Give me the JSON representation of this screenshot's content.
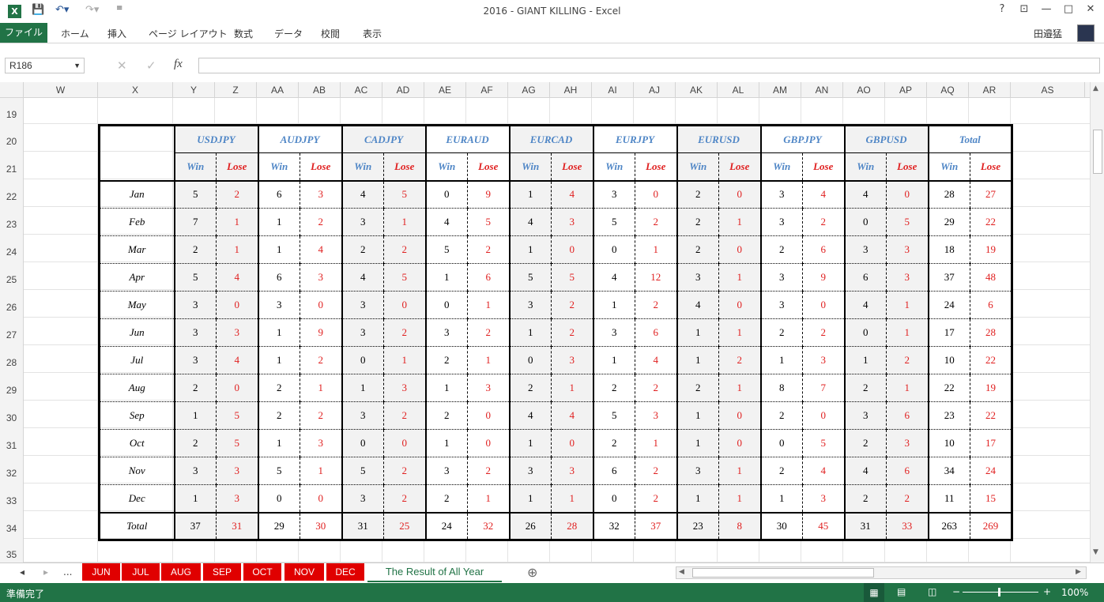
{
  "window": {
    "title": "2016 - GIANT KILLING - Excel",
    "user": "田邉猛",
    "help": "?",
    "minimize": "—",
    "restore": "□",
    "close": "✕",
    "ribbon_opts": "⊡"
  },
  "ribbon": {
    "tabs": [
      "ファイル",
      "ホーム",
      "挿入",
      "ページ レイアウト",
      "数式",
      "データ",
      "校閲",
      "表示"
    ]
  },
  "formula_bar": {
    "name_box": "R186",
    "fx": "fx",
    "cancel": "✕",
    "enter": "✓",
    "value": ""
  },
  "columns": [
    "W",
    "X",
    "Y",
    "Z",
    "AA",
    "AB",
    "AC",
    "AD",
    "AE",
    "AF",
    "AG",
    "AH",
    "AI",
    "AJ",
    "AK",
    "AL",
    "AM",
    "AN",
    "AO",
    "AP",
    "AQ",
    "AR",
    "AS"
  ],
  "rows": [
    "19",
    "20",
    "21",
    "22",
    "23",
    "24",
    "25",
    "26",
    "27",
    "28",
    "29",
    "30",
    "31",
    "32",
    "33",
    "34",
    "35"
  ],
  "table": {
    "pairs": [
      "USDJPY",
      "AUDJPY",
      "CADJPY",
      "EURAUD",
      "EURCAD",
      "EURJPY",
      "EURUSD",
      "GBPJPY",
      "GBPUSD",
      "Total"
    ],
    "win_label": "Win",
    "lose_label": "Lose",
    "months": [
      "Jan",
      "Feb",
      "Mar",
      "Apr",
      "May",
      "Jun",
      "Jul",
      "Aug",
      "Sep",
      "Oct",
      "Nov",
      "Dec"
    ],
    "data": [
      [
        5,
        2,
        6,
        3,
        4,
        5,
        0,
        9,
        1,
        4,
        3,
        0,
        2,
        0,
        3,
        4,
        4,
        0,
        28,
        27
      ],
      [
        7,
        1,
        1,
        2,
        3,
        1,
        4,
        5,
        4,
        3,
        5,
        2,
        2,
        1,
        3,
        2,
        0,
        5,
        29,
        22
      ],
      [
        2,
        1,
        1,
        4,
        2,
        2,
        5,
        2,
        1,
        0,
        0,
        1,
        2,
        0,
        2,
        6,
        3,
        3,
        18,
        19
      ],
      [
        5,
        4,
        6,
        3,
        4,
        5,
        1,
        6,
        5,
        5,
        4,
        12,
        3,
        1,
        3,
        9,
        6,
        3,
        37,
        48
      ],
      [
        3,
        0,
        3,
        0,
        3,
        0,
        0,
        1,
        3,
        2,
        1,
        2,
        4,
        0,
        3,
        0,
        4,
        1,
        24,
        6
      ],
      [
        3,
        3,
        1,
        9,
        3,
        2,
        3,
        2,
        1,
        2,
        3,
        6,
        1,
        1,
        2,
        2,
        0,
        1,
        17,
        28
      ],
      [
        3,
        4,
        1,
        2,
        0,
        1,
        2,
        1,
        0,
        3,
        1,
        4,
        1,
        2,
        1,
        3,
        1,
        2,
        10,
        22
      ],
      [
        2,
        0,
        2,
        1,
        1,
        3,
        1,
        3,
        2,
        1,
        2,
        2,
        2,
        1,
        8,
        7,
        2,
        1,
        22,
        19
      ],
      [
        1,
        5,
        2,
        2,
        3,
        2,
        2,
        0,
        4,
        4,
        5,
        3,
        1,
        0,
        2,
        0,
        3,
        6,
        23,
        22
      ],
      [
        2,
        5,
        1,
        3,
        0,
        0,
        1,
        0,
        1,
        0,
        2,
        1,
        1,
        0,
        0,
        5,
        2,
        3,
        10,
        17
      ],
      [
        3,
        3,
        5,
        1,
        5,
        2,
        3,
        2,
        3,
        3,
        6,
        2,
        3,
        1,
        2,
        4,
        4,
        6,
        34,
        24
      ],
      [
        1,
        3,
        0,
        0,
        3,
        2,
        2,
        1,
        1,
        1,
        0,
        2,
        1,
        1,
        1,
        3,
        2,
        2,
        11,
        15
      ]
    ],
    "total_label": "Total",
    "totals": [
      37,
      31,
      29,
      30,
      31,
      25,
      24,
      32,
      26,
      28,
      32,
      37,
      23,
      8,
      30,
      45,
      31,
      33,
      263,
      269
    ]
  },
  "sheets": {
    "nav_prev": "◂",
    "nav_next": "▸",
    "more": "...",
    "tabs": [
      "JUN",
      "JUL",
      "AUG",
      "SEP",
      "OCT",
      "NOV",
      "DEC"
    ],
    "active": "The Result of All Year",
    "add": "⊕"
  },
  "status": {
    "text": "準備完了",
    "zoom": "100%",
    "zoom_out": "−",
    "zoom_in": "+"
  }
}
